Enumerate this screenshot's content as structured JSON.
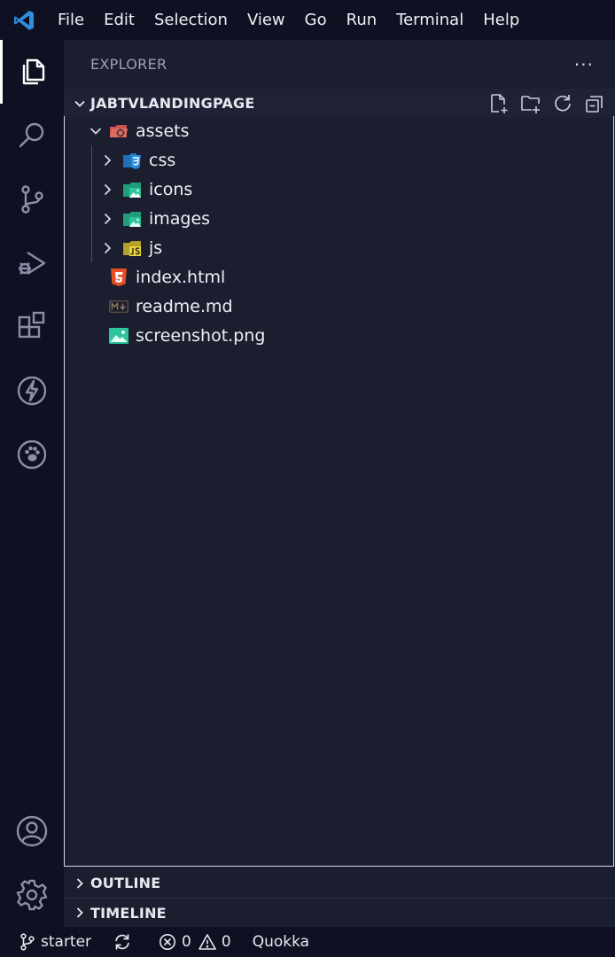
{
  "menu": [
    "File",
    "Edit",
    "Selection",
    "View",
    "Go",
    "Run",
    "Terminal",
    "Help"
  ],
  "icons": {
    "app": "vscode-logo-icon",
    "activity": [
      "explorer-icon",
      "search-icon",
      "source-control-icon",
      "run-debug-icon",
      "extensions-icon",
      "lightning-icon",
      "paw-icon",
      "account-icon",
      "settings-gear-icon"
    ]
  },
  "sidebar": {
    "title": "EXPLORER",
    "more": "···",
    "project": {
      "name": "JABTVLANDINGPAGE",
      "actions": [
        "new-file-icon",
        "new-folder-icon",
        "refresh-icon",
        "collapse-all-icon"
      ]
    },
    "tree": [
      {
        "label": "assets",
        "kind": "folder-open"
      },
      {
        "label": "css",
        "kind": "folder"
      },
      {
        "label": "icons",
        "kind": "folder"
      },
      {
        "label": "images",
        "kind": "folder"
      },
      {
        "label": "js",
        "kind": "folder"
      },
      {
        "label": "index.html",
        "kind": "file"
      },
      {
        "label": "readme.md",
        "kind": "file"
      },
      {
        "label": "screenshot.png",
        "kind": "file"
      }
    ],
    "outline": "OUTLINE",
    "timeline": "TIMELINE"
  },
  "status": {
    "branch": "starter",
    "errors": "0",
    "warnings": "0",
    "quokka": "Quokka"
  },
  "colors": {
    "background": "#1b1e2e",
    "bars": "#0f1021",
    "accent": "#2f8fe0"
  }
}
